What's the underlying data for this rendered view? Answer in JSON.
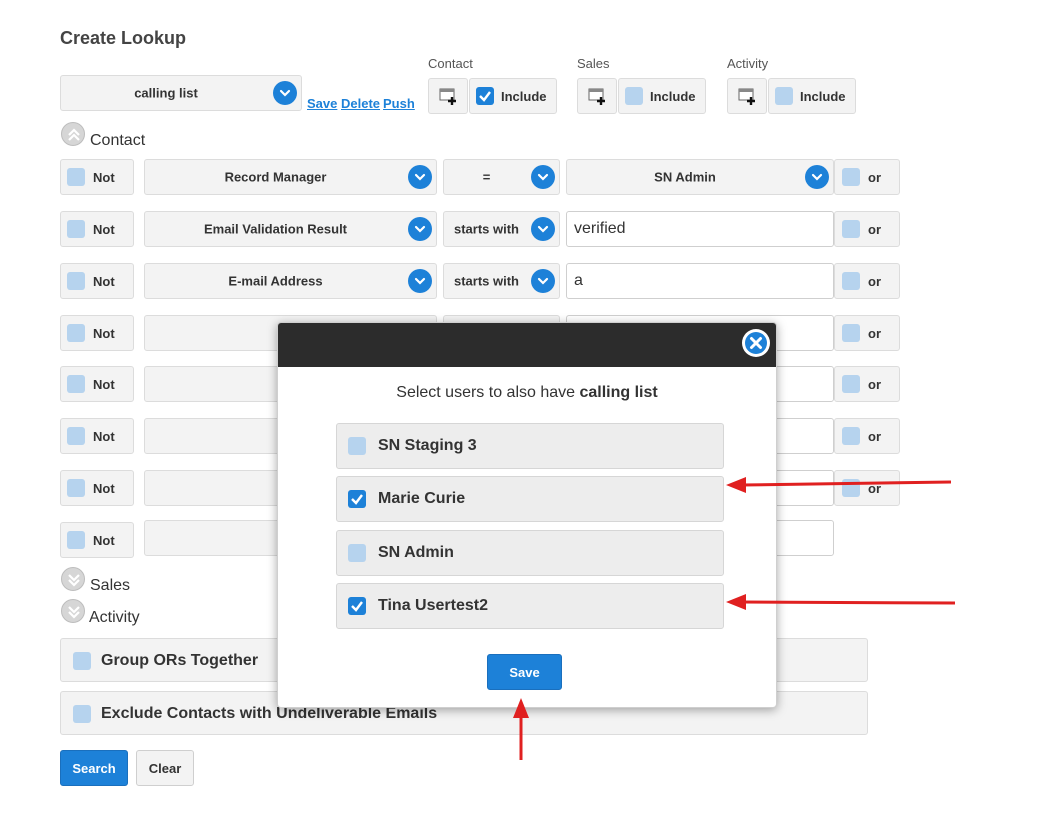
{
  "page_title": "Create Lookup",
  "lookup": {
    "selected": "calling list",
    "links": [
      "Save",
      "Delete",
      "Push"
    ]
  },
  "sections_header": [
    {
      "name": "Contact",
      "include_label": "Include",
      "checked": true
    },
    {
      "name": "Sales",
      "include_label": "Include",
      "checked": false
    },
    {
      "name": "Activity",
      "include_label": "Include",
      "checked": false
    }
  ],
  "contact_section": "Contact",
  "criteria": [
    {
      "not": "Not",
      "field": "Record Manager",
      "op": "=",
      "value": "SN Admin",
      "value_type": "select",
      "or": "or"
    },
    {
      "not": "Not",
      "field": "Email Validation Result",
      "op": "starts with",
      "value": "verified",
      "value_type": "text",
      "or": "or"
    },
    {
      "not": "Not",
      "field": "E-mail Address",
      "op": "starts with",
      "value": "a",
      "value_type": "text",
      "or": "or"
    },
    {
      "not": "Not",
      "or": "or"
    },
    {
      "not": "Not",
      "or": "or"
    },
    {
      "not": "Not",
      "or": "or"
    },
    {
      "not": "Not",
      "or": "or"
    },
    {
      "not": "Not"
    }
  ],
  "sales_section": "Sales",
  "activity_section": "Activity",
  "options": {
    "group_ors": "Group ORs Together",
    "exclude_undeliverable": "Exclude Contacts with Undeliverable Emails"
  },
  "buttons": {
    "search": "Search",
    "clear": "Clear"
  },
  "modal": {
    "message_prefix": "Select users to also have ",
    "message_bold": "calling list",
    "users": [
      {
        "name": "SN Staging 3",
        "checked": false
      },
      {
        "name": "Marie Curie",
        "checked": true
      },
      {
        "name": "SN Admin",
        "checked": false
      },
      {
        "name": "Tina Usertest2",
        "checked": true
      }
    ],
    "save_label": "Save"
  },
  "colors": {
    "accent": "#1d81d8",
    "annotation_arrow": "#e02020"
  }
}
